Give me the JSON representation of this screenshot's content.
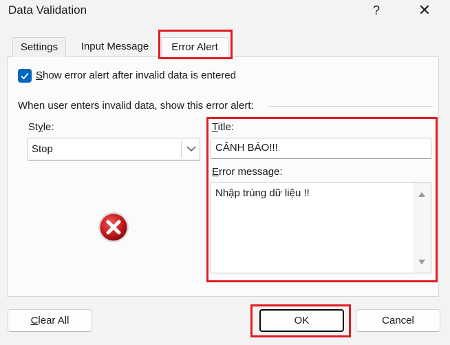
{
  "window": {
    "title": "Data Validation",
    "help_label": "?",
    "close_label": "✕"
  },
  "tabs": [
    {
      "label": "Settings"
    },
    {
      "label": "Input Message"
    },
    {
      "label": "Error Alert",
      "selected": true
    }
  ],
  "show_alert": {
    "checked": true,
    "label_first": "S",
    "label_rest": "how error alert after invalid data is entered"
  },
  "section_label": "When user enters invalid data, show this error alert:",
  "style": {
    "label_first": "St",
    "label_mid": "y",
    "label_rest": "le:",
    "value": "Stop"
  },
  "alert_title": {
    "label_first": "T",
    "label_rest": "itle:",
    "value": "CẢNH BÁO!!!"
  },
  "error_message": {
    "label_first": "E",
    "label_rest": "rror message:",
    "value": "Nhập trùng dữ liệu !!"
  },
  "buttons": {
    "clear_first": "C",
    "clear_rest": "lear All",
    "ok": "OK",
    "cancel": "Cancel"
  },
  "colors": {
    "accent": "#0067c0",
    "highlight": "#e11b22",
    "error_icon": "#c0161c"
  }
}
